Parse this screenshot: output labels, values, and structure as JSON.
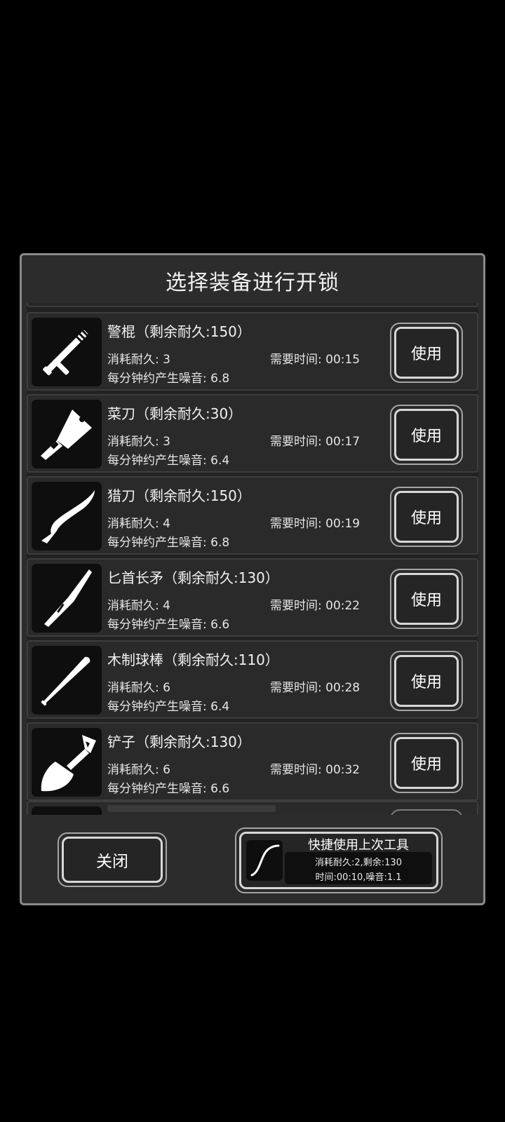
{
  "dialog": {
    "title": "选择装备进行开锁"
  },
  "items": [
    {
      "name": "警棍（剩余耐久:150）",
      "cost": "消耗耐久: 3",
      "time": "需要时间: 00:15",
      "noise": "每分钟约产生噪音: 6.8",
      "button": "使用",
      "icon": "baton-icon"
    },
    {
      "name": "菜刀（剩余耐久:30）",
      "cost": "消耗耐久: 3",
      "time": "需要时间: 00:17",
      "noise": "每分钟约产生噪音: 6.4",
      "button": "使用",
      "icon": "cleaver-icon"
    },
    {
      "name": "猎刀（剩余耐久:150）",
      "cost": "消耗耐久: 4",
      "time": "需要时间: 00:19",
      "noise": "每分钟约产生噪音: 6.8",
      "button": "使用",
      "icon": "kukri-icon"
    },
    {
      "name": "匕首长矛（剩余耐久:130）",
      "cost": "消耗耐久: 4",
      "time": "需要时间: 00:22",
      "noise": "每分钟约产生噪音: 6.6",
      "button": "使用",
      "icon": "dagger-spear-icon"
    },
    {
      "name": "木制球棒（剩余耐久:110）",
      "cost": "消耗耐久: 6",
      "time": "需要时间: 00:28",
      "noise": "每分钟约产生噪音: 6.4",
      "button": "使用",
      "icon": "baseball-bat-icon"
    },
    {
      "name": "铲子（剩余耐久:130）",
      "cost": "消耗耐久: 6",
      "time": "需要时间: 00:32",
      "noise": "每分钟约产生噪音: 6.6",
      "button": "使用",
      "icon": "shovel-icon"
    }
  ],
  "footer": {
    "close_label": "关闭",
    "quick": {
      "title": "快捷使用上次工具",
      "line1": "消耗耐久:2,剩余:130",
      "line2": "时间:00:10,噪音:1.1",
      "icon": "wire-icon"
    }
  }
}
